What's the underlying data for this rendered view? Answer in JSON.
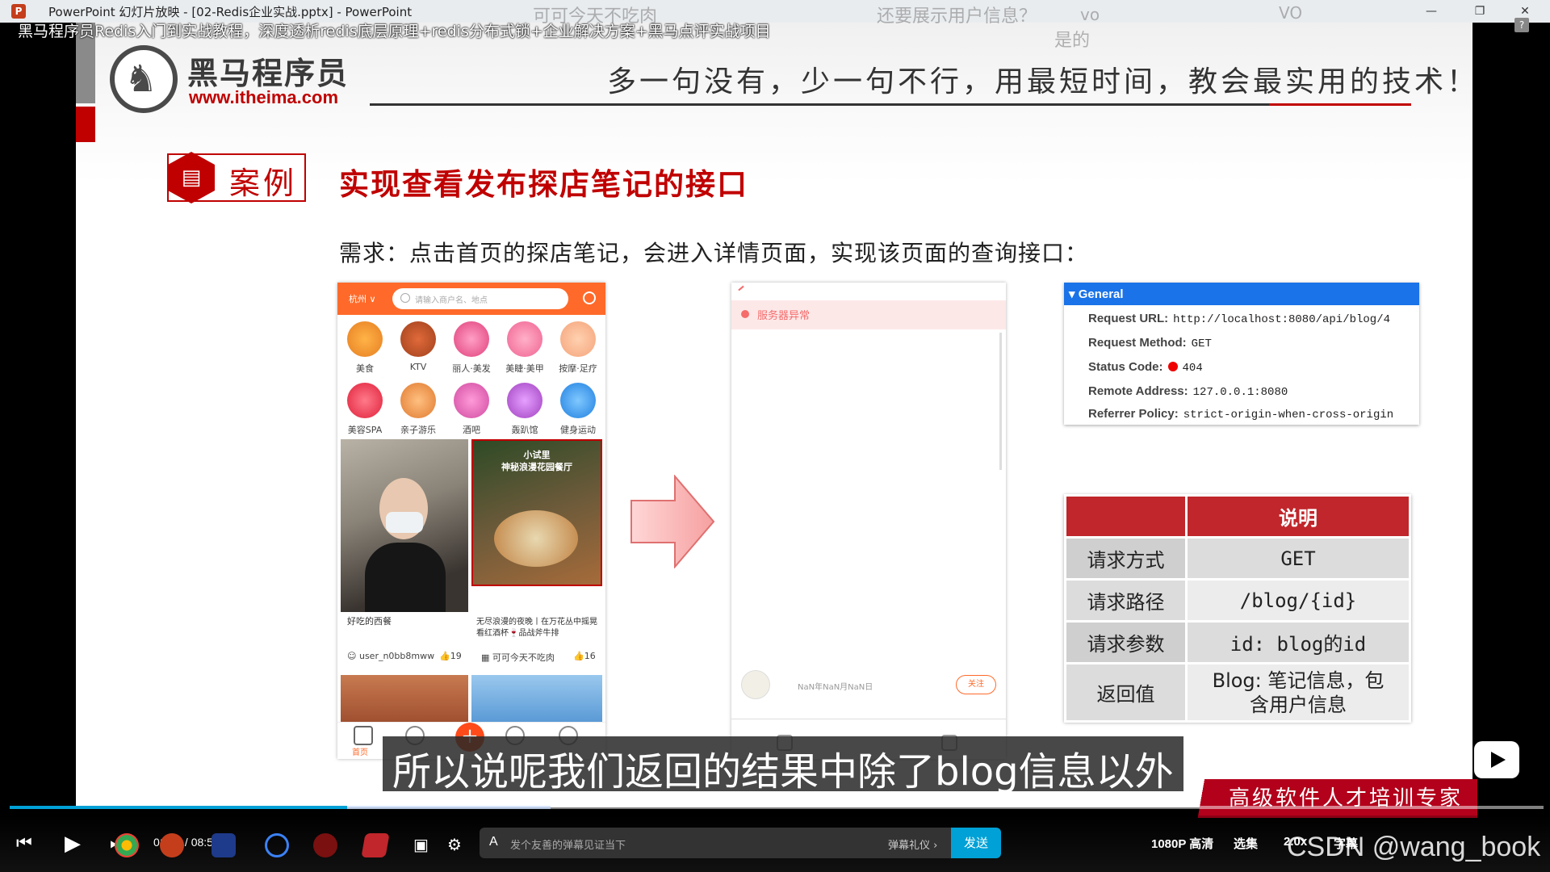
{
  "window": {
    "app_title": "PowerPoint 幻灯片放映 - [02-Redis企业实战.pptx] - PowerPoint",
    "app_logo": "P"
  },
  "danmaku": [
    "可可今天不吃肉",
    "还要展示用户信息？",
    "vo",
    "VO",
    "是的"
  ],
  "video_title": "黑马程序员Redis入门到实战教程，深度透析redis底层原理+redis分布式锁+企业解决方案+黑马点评实战项目",
  "slide": {
    "logo_name": "黑马程序员",
    "logo_url": "www.itheima.com",
    "motto": "多一句没有，少一句不行，用最短时间，教会最实用的技术！",
    "case_label": "案例",
    "title": "实现查看发布探店笔记的接口",
    "requirement": "需求：点击首页的探店笔记，会进入详情页面，实现该页面的查询接口：",
    "phone1": {
      "city": "杭州 ∨",
      "search_placeholder": "请输入商户名、地点",
      "categories": [
        "美食",
        "KTV",
        "丽人·美发",
        "美睫·美甲",
        "按摩·足疗",
        "美容SPA",
        "亲子游乐",
        "酒吧",
        "轰趴馆",
        "健身运动"
      ],
      "card1_caption": "好吃的西餐",
      "card1_user": "user_n0bb8mww",
      "card1_likes": "19",
      "card2_overlay_1": "小试里",
      "card2_overlay_2": "神秘浪漫花园餐厅",
      "card2_caption": "无尽浪漫的夜晚丨在万花丛中摇晃看红酒杯🍷品战斧牛排",
      "card2_user": "可可今天不吃肉",
      "card2_likes": "16",
      "nav_home": "首页",
      "nav_plus": "+"
    },
    "phone2": {
      "error_text": "服务器异常",
      "date_text": "NaN年NaN月NaN日",
      "follow_label": "关注"
    },
    "general": {
      "header": "General",
      "rows": [
        {
          "key": "Request URL:",
          "value": "http://localhost:8080/api/blog/4"
        },
        {
          "key": "Request Method:",
          "value": "GET"
        },
        {
          "key": "Status Code:",
          "value": "404"
        },
        {
          "key": "Remote Address:",
          "value": "127.0.0.1:8080"
        },
        {
          "key": "Referrer Policy:",
          "value": "strict-origin-when-cross-origin"
        }
      ]
    },
    "info_table": {
      "header": "说明",
      "rows": [
        {
          "label": "请求方式",
          "value": "GET"
        },
        {
          "label": "请求路径",
          "value": "/blog/{id}"
        },
        {
          "label": "请求参数",
          "value": "id: blog的id"
        },
        {
          "label": "返回值",
          "value_line1": "Blog: 笔记信息，包",
          "value_line2": "含用户信息"
        }
      ]
    },
    "slogan": "高级软件人才培训专家"
  },
  "subtitle": "所以说呢我们返回的结果中除了blog信息以外",
  "player": {
    "time": "01:58 / 08:54",
    "progress": 0.22,
    "danmaku_placeholder": "发个友善的弹幕见证当下",
    "danmaku_etiquette": "弹幕礼仪 ›",
    "send_label": "发送",
    "quality": "1080P 高清",
    "episodes": "选集",
    "speed": "2.0x",
    "subtitle_toggle": "字幕"
  },
  "watermark": "CSDN @wang_book",
  "colors": {
    "accent_red": "#c00000",
    "bili_blue": "#00a1d6",
    "devtools_blue": "#1a73e8"
  }
}
